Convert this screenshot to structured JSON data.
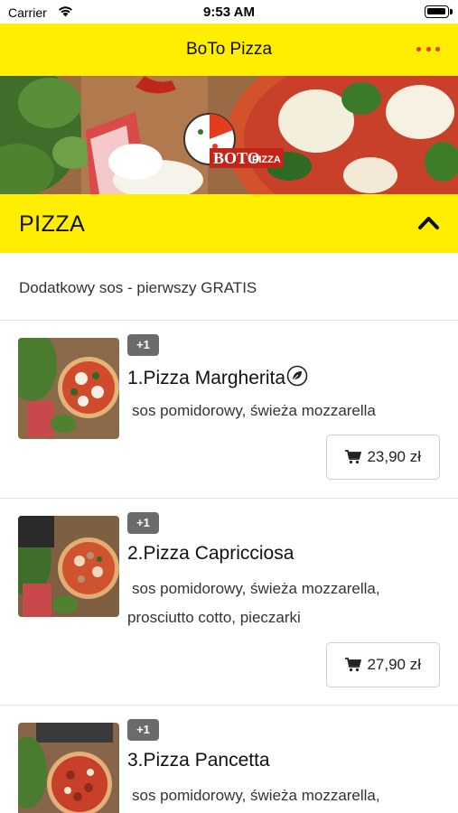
{
  "status_bar": {
    "carrier": "Carrier",
    "time": "9:53 AM"
  },
  "nav": {
    "title": "BoTo Pizza",
    "more_icon": "more-dots-icon"
  },
  "banner": {
    "logo_text": "BOTO",
    "logo_sub": "PIZZA"
  },
  "category": {
    "title": "PIZZA",
    "note": "Dodatkowy sos - pierwszy GRATIS"
  },
  "items": [
    {
      "badge": "+1",
      "name": "1.Pizza Margherita",
      "vegetarian": true,
      "description": "sos pomidorowy, świeża mozzarella",
      "description2": "",
      "price": "23,90 zł"
    },
    {
      "badge": "+1",
      "name": "2.Pizza Capricciosa",
      "vegetarian": false,
      "description": "sos pomidorowy, świeża mozzarella,",
      "description2": "prosciutto cotto, pieczarki",
      "price": "27,90 zł"
    },
    {
      "badge": "+1",
      "name": "3.Pizza Pancetta",
      "vegetarian": false,
      "description": "sos pomidorowy, świeża mozzarella,",
      "description2": "",
      "price": ""
    }
  ],
  "colors": {
    "brand_yellow": "#ffee00",
    "accent_red": "#e63c1e",
    "badge_gray": "#6b6b6b"
  }
}
